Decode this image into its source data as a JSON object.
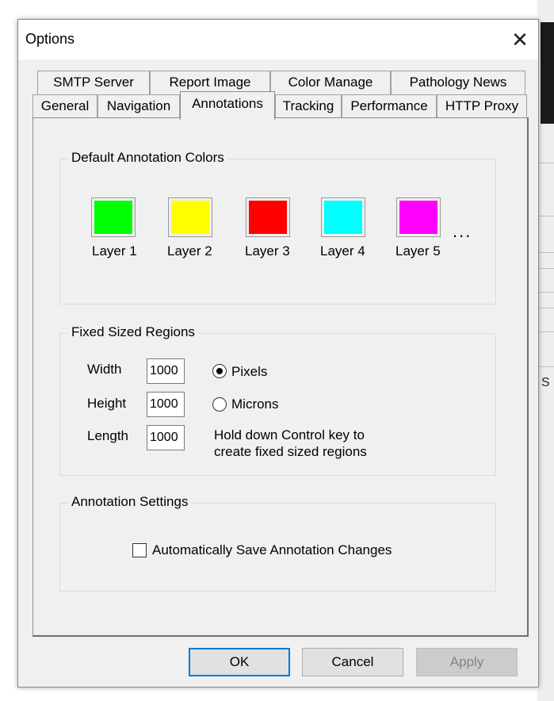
{
  "window": {
    "title": "Options",
    "close_glyph": "✕"
  },
  "tabs": {
    "row1": [
      {
        "label": "SMTP Server"
      },
      {
        "label": "Report Image"
      },
      {
        "label": "Color Manage"
      },
      {
        "label": "Pathology News"
      }
    ],
    "row2": [
      {
        "label": "General"
      },
      {
        "label": "Navigation"
      },
      {
        "label": "Annotations",
        "active": true
      },
      {
        "label": "Tracking"
      },
      {
        "label": "Performance"
      },
      {
        "label": "HTTP Proxy"
      }
    ]
  },
  "default_colors": {
    "heading": "Default Annotation Colors",
    "layers": [
      {
        "label": "Layer 1",
        "color": "#00ff00"
      },
      {
        "label": "Layer 2",
        "color": "#ffff00"
      },
      {
        "label": "Layer 3",
        "color": "#ff0000"
      },
      {
        "label": "Layer 4",
        "color": "#00ffff"
      },
      {
        "label": "Layer 5",
        "color": "#ff00ff"
      }
    ],
    "more_label": "..."
  },
  "fixed_regions": {
    "heading": "Fixed Sized Regions",
    "width_label": "Width",
    "width_value": "1000",
    "height_label": "Height",
    "height_value": "1000",
    "length_label": "Length",
    "length_value": "1000",
    "unit_options": [
      {
        "label": "Pixels",
        "selected": true
      },
      {
        "label": "Microns",
        "selected": false
      }
    ],
    "hint": "Hold down Control key to create fixed sized regions"
  },
  "annotation_settings": {
    "heading": "Annotation Settings",
    "autosave_label": "Automatically Save Annotation Changes",
    "autosave_checked": false
  },
  "buttons": {
    "ok": "OK",
    "cancel": "Cancel",
    "apply": "Apply",
    "apply_enabled": false
  }
}
